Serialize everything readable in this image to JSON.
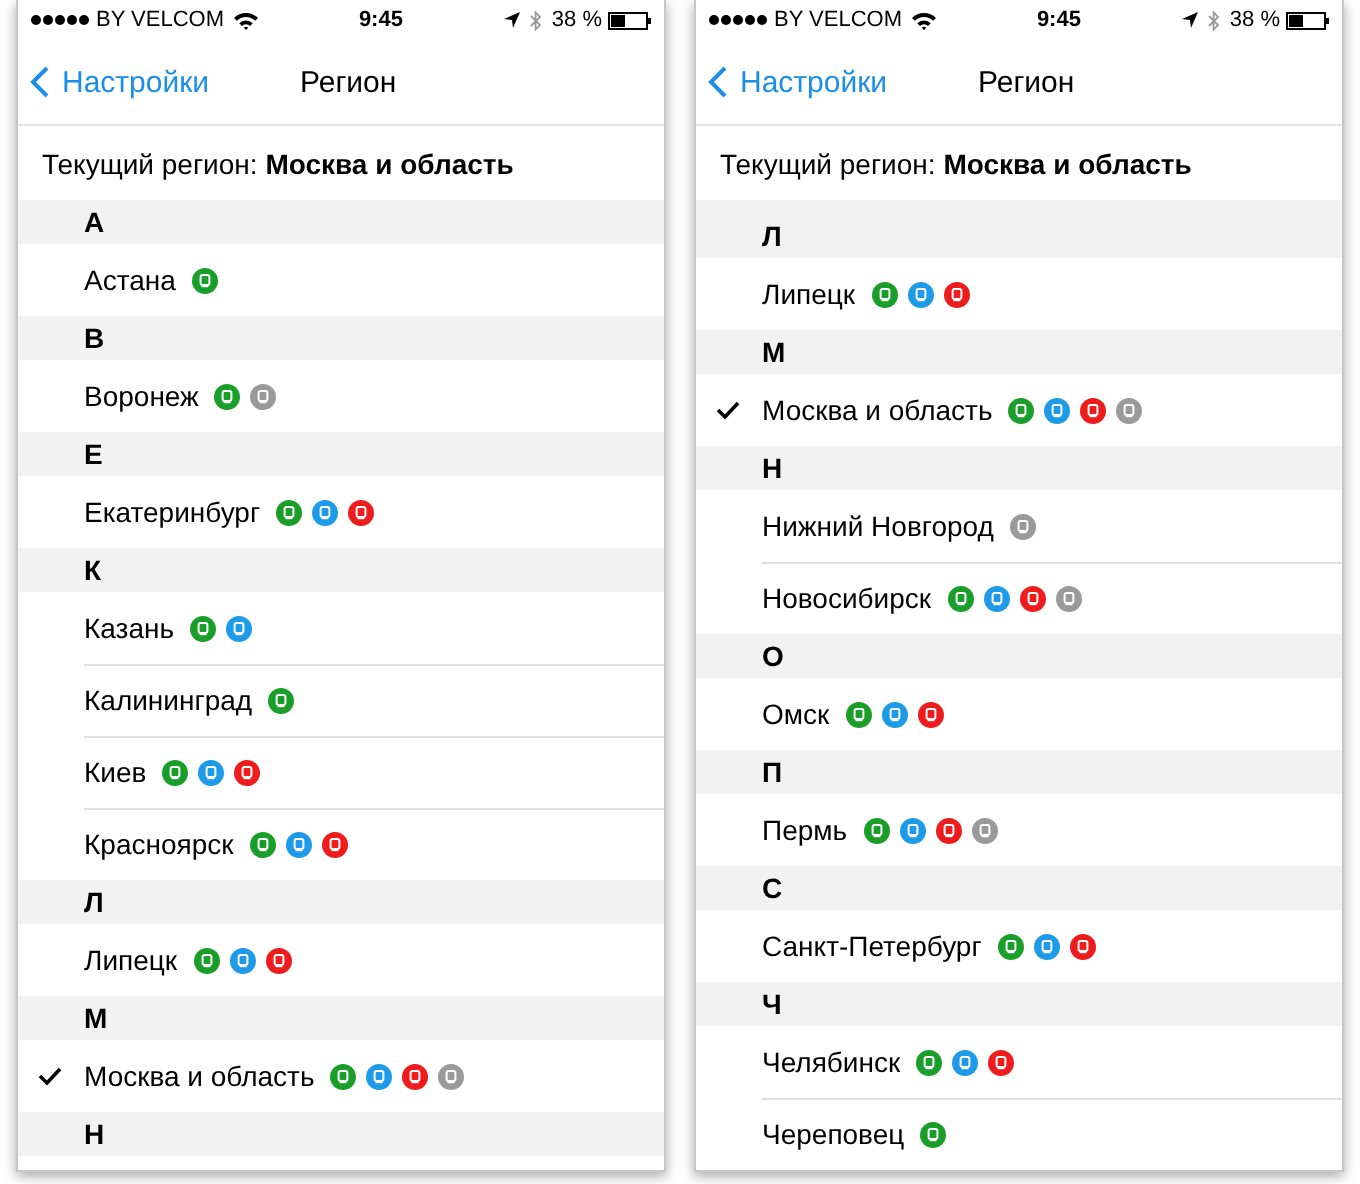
{
  "screens": [
    {
      "scrolled": false,
      "status_bar": {
        "carrier": "BY VELCOM",
        "time": "9:45",
        "battery": "38 %"
      },
      "nav": {
        "back": "Настройки",
        "title": "Регион"
      },
      "current_region": "Текущий регион: **Москва и область**",
      "sections": [
        {
          "letter": "А",
          "rows": [
            {
              "name": "Астана",
              "selected": false,
              "icons": [
                {
                  "color": "#1a9e2a"
                }
              ]
            }
          ]
        },
        {
          "letter": "В",
          "rows": [
            {
              "name": "Воронеж",
              "selected": false,
              "icons": [
                {
                  "color": "#1a9e2a"
                },
                {
                  "color": "#9a9a9a"
                }
              ]
            }
          ]
        },
        {
          "letter": "Е",
          "rows": [
            {
              "name": "Екатеринбург",
              "selected": false,
              "icons": [
                {
                  "color": "#1a9e2a"
                },
                {
                  "color": "#1e9be8"
                },
                {
                  "color": "#ee1c1c"
                }
              ]
            }
          ]
        },
        {
          "letter": "К",
          "rows": [
            {
              "name": "Казань",
              "selected": false,
              "icons": [
                {
                  "color": "#1a9e2a"
                },
                {
                  "color": "#1e9be8"
                }
              ]
            },
            {
              "name": "Калининград",
              "selected": false,
              "icons": [
                {
                  "color": "#1a9e2a"
                }
              ]
            },
            {
              "name": "Киев",
              "selected": false,
              "icons": [
                {
                  "color": "#1a9e2a"
                },
                {
                  "color": "#1e9be8"
                },
                {
                  "color": "#ee1c1c"
                }
              ]
            },
            {
              "name": "Красноярск",
              "selected": false,
              "icons": [
                {
                  "color": "#1a9e2a"
                },
                {
                  "color": "#1e9be8"
                },
                {
                  "color": "#ee1c1c"
                }
              ]
            }
          ]
        },
        {
          "letter": "Л",
          "rows": [
            {
              "name": "Липецк",
              "selected": false,
              "icons": [
                {
                  "color": "#1a9e2a"
                },
                {
                  "color": "#1e9be8"
                },
                {
                  "color": "#ee1c1c"
                }
              ]
            }
          ]
        },
        {
          "letter": "М",
          "rows": [
            {
              "name": "Москва и область",
              "selected": true,
              "icons": [
                {
                  "color": "#1a9e2a"
                },
                {
                  "color": "#1e9be8"
                },
                {
                  "color": "#ee1c1c"
                },
                {
                  "color": "#9a9a9a"
                }
              ]
            }
          ]
        },
        {
          "letter": "Н"
        }
      ]
    },
    {
      "scrolled": true,
      "status_bar": {
        "carrier": "BY VELCOM",
        "time": "9:45",
        "battery": "38 %"
      },
      "nav": {
        "back": "Настройки",
        "title": "Регион"
      },
      "current_region": "Текущий регион: **Москва и область**",
      "sections": [
        {
          "letter": "Л",
          "rows": [
            {
              "name": "Липецк",
              "selected": false,
              "icons": [
                {
                  "color": "#1a9e2a"
                },
                {
                  "color": "#1e9be8"
                },
                {
                  "color": "#ee1c1c"
                }
              ]
            }
          ]
        },
        {
          "letter": "М",
          "rows": [
            {
              "name": "Москва и область",
              "selected": true,
              "icons": [
                {
                  "color": "#1a9e2a"
                },
                {
                  "color": "#1e9be8"
                },
                {
                  "color": "#ee1c1c"
                },
                {
                  "color": "#9a9a9a"
                }
              ]
            }
          ]
        },
        {
          "letter": "Н",
          "rows": [
            {
              "name": "Нижний Новгород",
              "selected": false,
              "icons": [
                {
                  "color": "#9a9a9a"
                }
              ]
            },
            {
              "name": "Новосибирск",
              "selected": false,
              "icons": [
                {
                  "color": "#1a9e2a"
                },
                {
                  "color": "#1e9be8"
                },
                {
                  "color": "#ee1c1c"
                },
                {
                  "color": "#9a9a9a"
                }
              ]
            }
          ]
        },
        {
          "letter": "О",
          "rows": [
            {
              "name": "Омск",
              "selected": false,
              "icons": [
                {
                  "color": "#1a9e2a"
                },
                {
                  "color": "#1e9be8"
                },
                {
                  "color": "#ee1c1c"
                }
              ]
            }
          ]
        },
        {
          "letter": "П",
          "rows": [
            {
              "name": "Пермь",
              "selected": false,
              "icons": [
                {
                  "color": "#1a9e2a"
                },
                {
                  "color": "#1e9be8"
                },
                {
                  "color": "#ee1c1c"
                },
                {
                  "color": "#9a9a9a"
                }
              ]
            }
          ]
        },
        {
          "letter": "С",
          "rows": [
            {
              "name": "Санкт-Петербург",
              "selected": false,
              "icons": [
                {
                  "color": "#1a9e2a"
                },
                {
                  "color": "#1e9be8"
                },
                {
                  "color": "#ee1c1c"
                }
              ]
            }
          ]
        },
        {
          "letter": "Ч",
          "rows": [
            {
              "name": "Челябинск",
              "selected": false,
              "icons": [
                {
                  "color": "#1a9e2a"
                },
                {
                  "color": "#1e9be8"
                },
                {
                  "color": "#ee1c1c"
                }
              ]
            },
            {
              "name": "Череповец",
              "selected": false,
              "icons": [
                {
                  "color": "#1a9e2a"
                }
              ]
            }
          ]
        }
      ]
    }
  ]
}
